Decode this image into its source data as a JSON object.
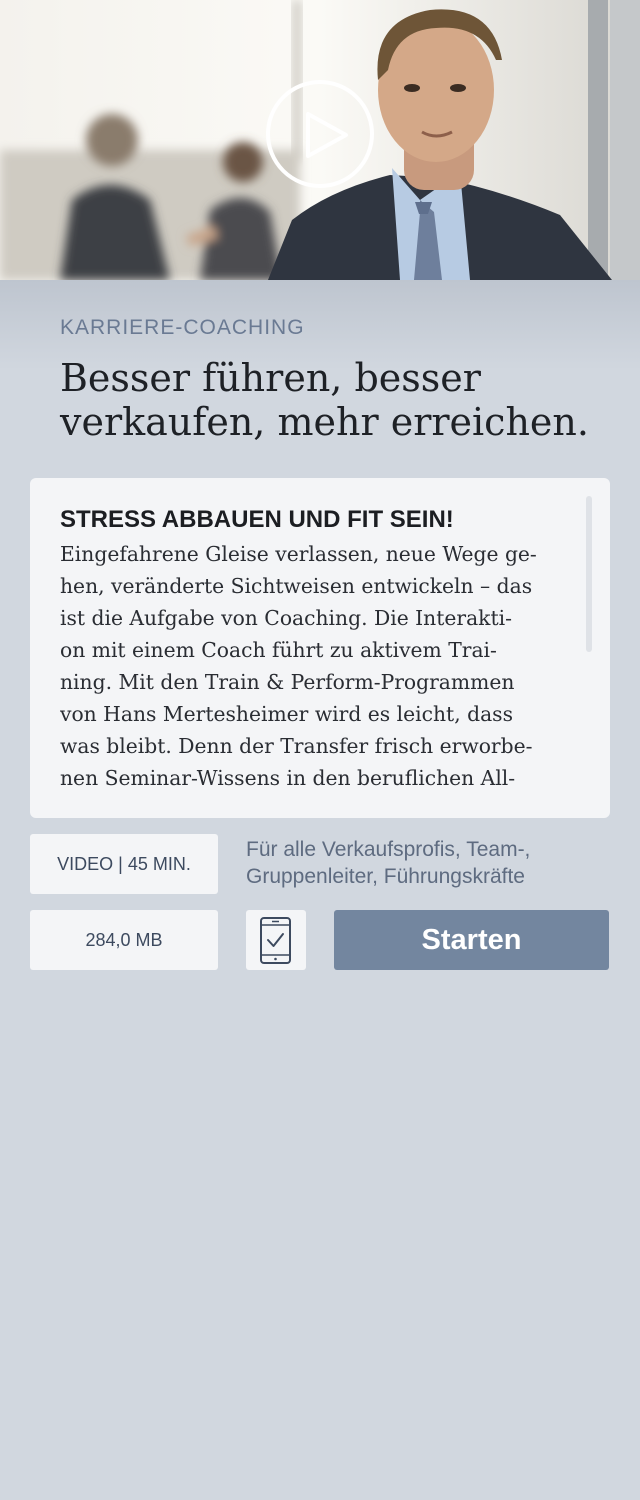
{
  "hero": {
    "image_description": "",
    "play_icon": "play-icon"
  },
  "course": {
    "category": "KARRIERE-COACHING",
    "title_lines": [
      "Besser führen, besser",
      "verkaufen, mehr erreichen."
    ]
  },
  "description": {
    "heading": "STRESS ABBAUEN UND FIT SEIN!",
    "lines": [
      "Eingefahrene Gleise verlassen, neue Wege ge-",
      "hen, veränderte Sichtweisen entwickeln – das",
      "ist die Aufgabe von Coaching. Die Interakti-",
      "on mit einem Coach führt zu aktivem Trai-",
      "ning. Mit den Train & Perform-Programmen",
      "von Hans Mertesheimer wird es leicht, dass",
      "was bleibt. Denn der Transfer frisch erworbe-",
      "nen Seminar-Wissens in den beruflichen All-"
    ]
  },
  "meta": {
    "type_duration": "VIDEO | 45 MIN.",
    "file_size": "284,0 MB",
    "audience_lines": [
      "Für alle Verkaufsprofis, Team-,",
      "Gruppenleiter, Führungskräfte"
    ],
    "device_icon": "mobile-check-icon"
  },
  "actions": {
    "start_label": "Starten"
  },
  "colors": {
    "background": "#d1d7df",
    "accent": "#73869f",
    "card": "#f4f5f7",
    "category_text": "#6a7a93"
  }
}
